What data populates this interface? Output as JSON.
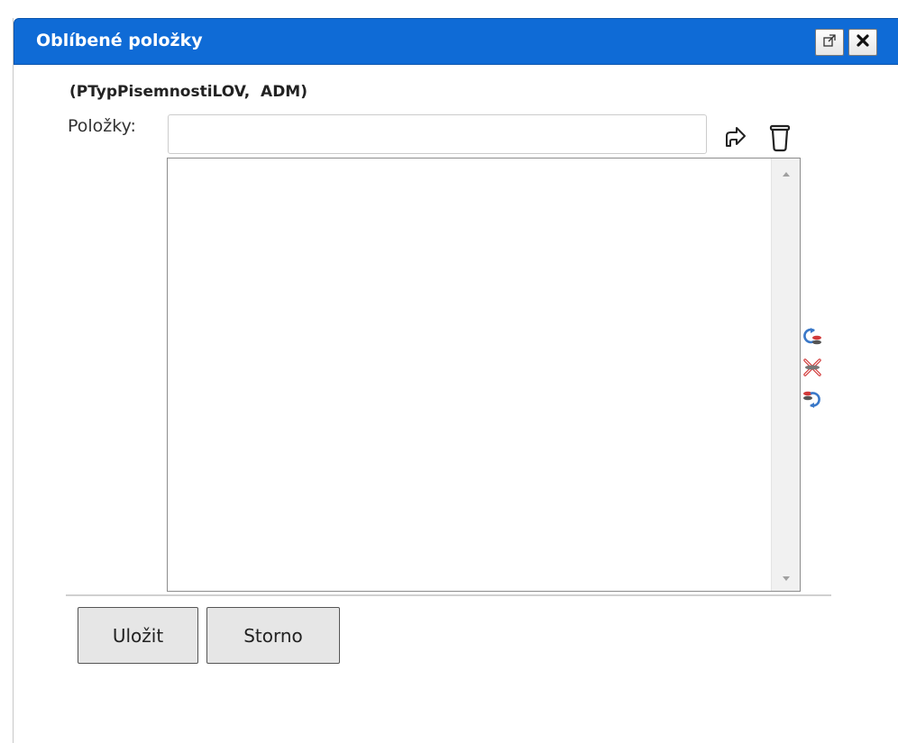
{
  "dialog": {
    "title": "Oblíbené položky",
    "subtitle": "(PTypPisemnostiLOV,  ADM)",
    "field_label": "Položky:",
    "search": {
      "value": "",
      "placeholder": ""
    },
    "list": {
      "items": []
    },
    "buttons": {
      "save_label": "Uložit",
      "cancel_label": "Storno"
    }
  },
  "icons": {
    "popout": "popout-icon",
    "close": "close-icon",
    "add": "add-arrow-icon",
    "delete": "trash-icon",
    "move_up": "move-up-icon",
    "remove": "remove-item-icon",
    "move_down": "move-down-icon"
  },
  "colors": {
    "titlebar": "#0f6bd6",
    "title_text": "#ffffff",
    "button_bg": "#e6e6e6",
    "accent_blue": "#3a78c8",
    "accent_red": "#d23a3a"
  }
}
